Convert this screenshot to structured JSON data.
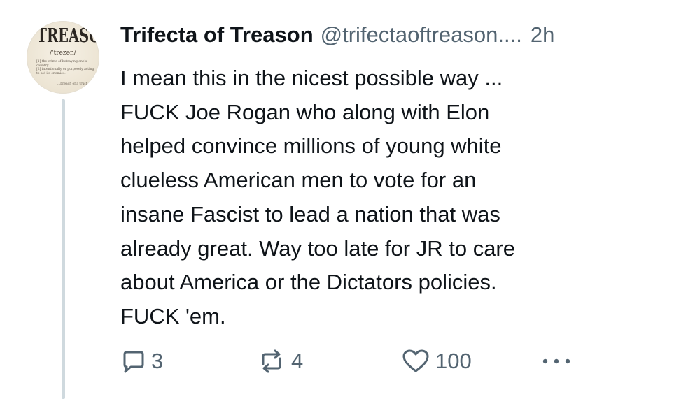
{
  "author": {
    "display_name": "Trifecta of Treason",
    "handle": "@trifectaoftreason....",
    "time": "2h",
    "avatar": {
      "word": "TREASON",
      "pronunciation": "/'trēzən/",
      "definition_1": "[1] the crime of betraying one's country.",
      "definition_2": "[2] intentionally or purposely acting to aid its enemies.",
      "definition_3": "...breach of a trust..."
    }
  },
  "post": {
    "text": "I mean this in the nicest possible way ...\nFUCK Joe Rogan who along with Elon\nhelped convince millions of young white\nclueless American men to vote for an\ninsane Fascist to lead a nation that was\nalready great. Way too late for JR to care\nabout America or the Dictators policies.\nFUCK 'em."
  },
  "actions": {
    "reply_count": "3",
    "repost_count": "4",
    "like_count": "100",
    "icons": [
      "reply-icon",
      "repost-icon",
      "heart-icon",
      "more-icon"
    ],
    "icon_color": "#536471"
  }
}
